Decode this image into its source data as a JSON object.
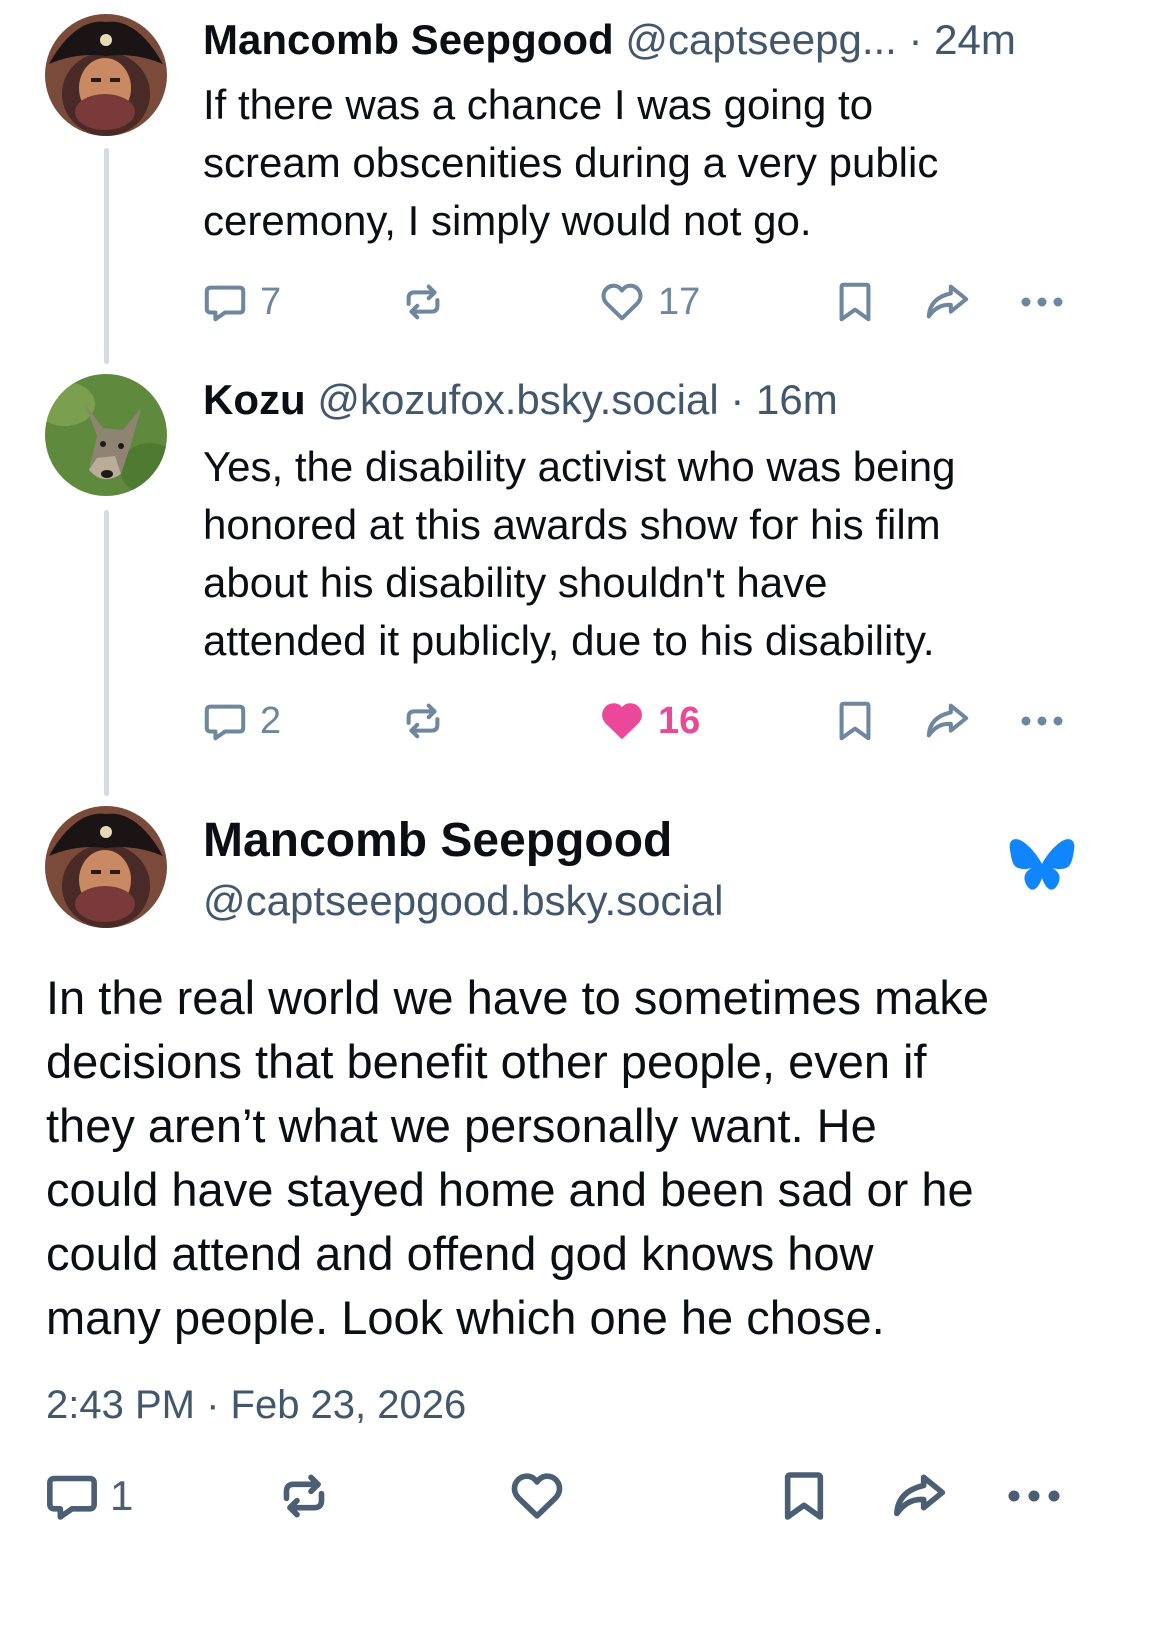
{
  "colors": {
    "like_active": "#ec4899",
    "bluesky_blue": "#1185fe",
    "action_gray": "#6f869f"
  },
  "posts": [
    {
      "author_name": "Mancomb Seepgood",
      "handle": "@captseepg...",
      "time": "· 24m",
      "avatar_icon": "pirate-avatar",
      "text_lines": [
        "If there was a chance I was going to",
        "scream obscenities during a very public",
        "ceremony, I simply would not go."
      ],
      "replies": "7",
      "likes": "17",
      "liked": false
    },
    {
      "author_name": "Kozu",
      "handle": "@kozufox.bsky.social",
      "time": "· 16m",
      "avatar_icon": "coyote-avatar",
      "text_lines": [
        "Yes, the disability activist who was being",
        "honored at this awards show for his film",
        "about his disability shouldn't have",
        "attended it publicly, due to his disability."
      ],
      "replies": "2",
      "likes": "16",
      "liked": true
    }
  ],
  "main_post": {
    "author_name": "Mancomb Seepgood",
    "handle": "@captseepgood.bsky.social",
    "avatar_icon": "pirate-avatar",
    "brand_icon": "bluesky-butterfly-icon",
    "text_lines": [
      "In the real world we have to sometimes make",
      "decisions that benefit other people, even if",
      "they aren’t what we personally want. He",
      "could have stayed home and been sad or he",
      "could attend and offend god knows how",
      "many people. Look which one he chose."
    ],
    "timestamp": "2:43 PM · Feb 23, 2026",
    "replies": "1"
  }
}
